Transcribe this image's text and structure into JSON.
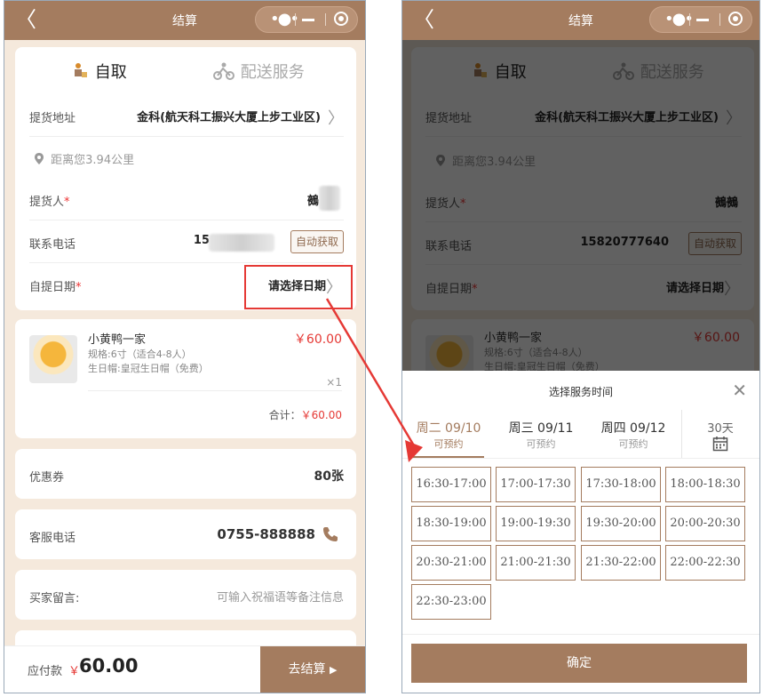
{
  "nav": {
    "title": "结算",
    "back_glyph": "〈",
    "more_glyph": "•●•"
  },
  "pickup_tabs": {
    "self": "自取",
    "delivery": "配送服务"
  },
  "address": {
    "label": "提货地址",
    "value": "金科(航天科工振兴大厦上步工业区)"
  },
  "distance": "距离您3.94公里",
  "picker": {
    "label": "提货人",
    "required_mark": "*",
    "value_left": "鵺",
    "value_right": "鵺鵺"
  },
  "phone": {
    "label": "联系电话",
    "value_left": "15",
    "value_right": "15820777640",
    "fetch_button": "自动获取"
  },
  "date": {
    "label": "自提日期",
    "required_mark": "*",
    "value": "请选择日期"
  },
  "product": {
    "name": "小黄鸭一家",
    "price": "￥60.00",
    "spec": "规格:6寸（适合4-8人）",
    "hat": "生日帽:皇冠生日帽（免费）",
    "qty": "×1",
    "subtotal_label": "合计：",
    "subtotal": "￥60.00"
  },
  "coupon": {
    "label": "优惠券",
    "value": "80张"
  },
  "service": {
    "label": "客服电话",
    "value": "0755-888888"
  },
  "message": {
    "label": "买家留言:",
    "placeholder": "可输入祝福语等备注信息"
  },
  "bottom": {
    "due_label": "应付款",
    "currency": "￥",
    "amount": "60.00",
    "pay_button": "去结算"
  },
  "time_sheet": {
    "title": "选择服务时间",
    "close_glyph": "✕",
    "tabs": [
      {
        "day": "周二 09/10",
        "status": "可预约"
      },
      {
        "day": "周三 09/11",
        "status": "可预约"
      },
      {
        "day": "周四 09/12",
        "status": "可预约"
      }
    ],
    "more_days": "30天",
    "slots": [
      "16:30-17:00",
      "17:00-17:30",
      "17:30-18:00",
      "18:00-18:30",
      "18:30-19:00",
      "19:00-19:30",
      "19:30-20:00",
      "20:00-20:30",
      "20:30-21:00",
      "21:00-21:30",
      "21:30-22:00",
      "22:00-22:30",
      "22:30-23:00"
    ],
    "confirm": "确定"
  },
  "colors": {
    "brand": "#a47c5f",
    "price_red": "#e53935",
    "highlight_red": "#e53935",
    "background": "#f5e9dc"
  }
}
